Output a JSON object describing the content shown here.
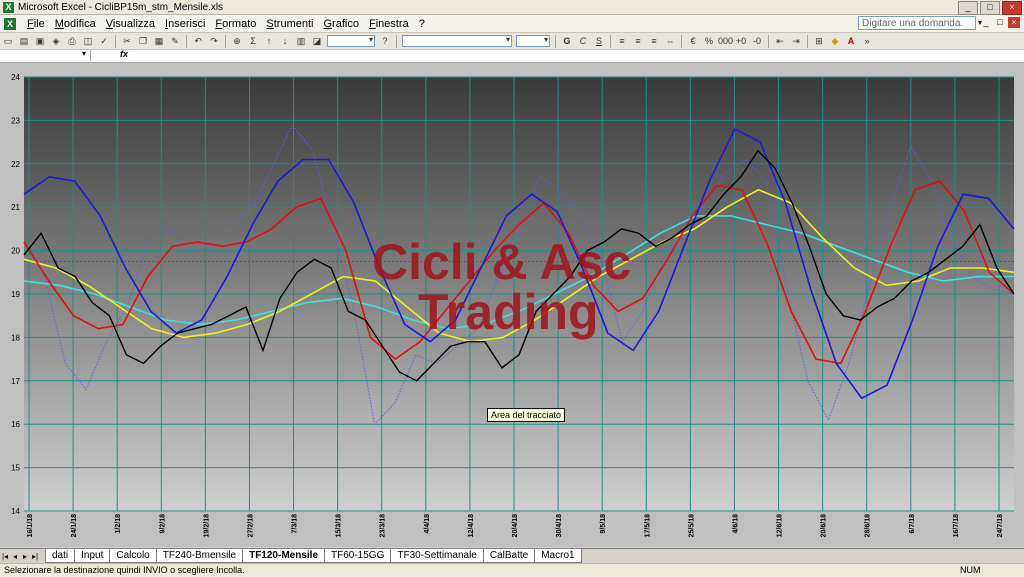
{
  "window": {
    "title": "Microsoft Excel - CicliBP15m_stm_Mensile.xls",
    "app_icon": "excel-icon",
    "buttons": [
      "_",
      "□",
      "×"
    ]
  },
  "menubar": {
    "items": [
      "File",
      "Modifica",
      "Visualizza",
      "Inserisci",
      "Formato",
      "Strumenti",
      "Grafico",
      "Finestra",
      "?"
    ],
    "ask_placeholder": "Digitare una domanda.",
    "doc_buttons": [
      "_",
      "□",
      "×"
    ]
  },
  "formulabar": {
    "fx": "fx"
  },
  "chart": {
    "watermark_line1": "Cicli & Asc",
    "watermark_line2": "Trading",
    "tooltip": "Area del tracciato",
    "colors": {
      "background_top": "#3a3a3a",
      "background_bottom": "#c8c8c8",
      "grid": "#1f8f86",
      "black_series": "#000000",
      "blue_series": "#1a1ad8",
      "red_series": "#e01010",
      "yellow_series": "#f0f020",
      "cyan_series": "#40e0e0",
      "dotted_series": "#6060e0",
      "reference_line": "#e02020"
    }
  },
  "chart_data": {
    "type": "line",
    "ylim": [
      14,
      24
    ],
    "yticks": [
      14,
      15,
      16,
      17,
      18,
      19,
      20,
      21,
      22,
      23,
      24
    ],
    "xticks": [
      "16/1/18",
      "24/1/18",
      "1/2/18",
      "9/2/18",
      "19/2/18",
      "27/2/18",
      "7/3/18",
      "15/3/18",
      "23/3/18",
      "4/4/18",
      "12/4/18",
      "20/4/18",
      "30/4/18",
      "9/5/18",
      "17/5/18",
      "25/5/18",
      "4/6/18",
      "12/6/18",
      "20/6/18",
      "28/6/18",
      "6/7/18",
      "16/7/18",
      "24/7/18"
    ],
    "reference_line": 19.75,
    "grid": true,
    "series": [
      {
        "color": "#000000",
        "style": "solid",
        "values": [
          19.9,
          20.4,
          19.6,
          19.4,
          18.8,
          18.5,
          17.6,
          17.4,
          17.8,
          18.1,
          18.2,
          18.3,
          18.5,
          18.7,
          17.7,
          18.9,
          19.5,
          19.8,
          19.6,
          18.6,
          18.4,
          17.8,
          17.2,
          17.0,
          17.4,
          17.8,
          17.9,
          17.9,
          17.3,
          17.6,
          18.6,
          19.0,
          19.4,
          20.0,
          20.2,
          20.5,
          20.4,
          20.1,
          20.3,
          20.6,
          20.8,
          21.3,
          21.7,
          22.3,
          21.9,
          21.1,
          20.1,
          19.0,
          18.5,
          18.4,
          18.7,
          18.9,
          19.3,
          19.5,
          19.8,
          20.1,
          20.6,
          19.6,
          19.0
        ]
      },
      {
        "color": "#1a1ad8",
        "style": "solid",
        "values": [
          21.3,
          21.7,
          21.6,
          20.8,
          19.6,
          18.6,
          18.1,
          18.4,
          19.4,
          20.6,
          21.6,
          22.1,
          22.1,
          21.1,
          19.6,
          18.3,
          17.9,
          18.4,
          19.6,
          20.8,
          21.3,
          20.9,
          19.6,
          18.1,
          17.7,
          18.6,
          20.1,
          21.6,
          22.8,
          22.5,
          21.1,
          19.1,
          17.4,
          16.6,
          16.9,
          18.4,
          20.1,
          21.3,
          21.2,
          20.5
        ]
      },
      {
        "color": "#e01010",
        "style": "solid",
        "values": [
          20.2,
          19.3,
          18.5,
          18.2,
          18.3,
          19.4,
          20.1,
          20.2,
          20.1,
          20.2,
          20.5,
          21.0,
          21.2,
          20.0,
          18.0,
          17.5,
          17.9,
          18.6,
          19.3,
          20.0,
          20.6,
          21.1,
          20.4,
          19.2,
          18.6,
          18.9,
          19.8,
          20.8,
          21.5,
          21.4,
          20.2,
          18.6,
          17.5,
          17.4,
          18.6,
          20.1,
          21.4,
          21.6,
          20.9,
          19.5,
          19.0
        ]
      },
      {
        "color": "#f0f020",
        "style": "solid",
        "values": [
          19.8,
          19.6,
          19.2,
          18.7,
          18.2,
          18.0,
          18.1,
          18.3,
          18.6,
          19.0,
          19.4,
          19.3,
          18.7,
          18.1,
          17.9,
          18.0,
          18.4,
          18.9,
          19.4,
          19.8,
          20.2,
          20.5,
          21.0,
          21.4,
          21.1,
          20.3,
          19.6,
          19.2,
          19.3,
          19.6,
          19.6,
          19.5
        ]
      },
      {
        "color": "#40e0e0",
        "style": "solid",
        "values": [
          19.3,
          19.2,
          19.0,
          18.7,
          18.4,
          18.3,
          18.4,
          18.6,
          18.8,
          18.9,
          18.7,
          18.4,
          18.2,
          18.3,
          18.6,
          19.0,
          19.4,
          19.9,
          20.4,
          20.8,
          20.8,
          20.6,
          20.4,
          20.1,
          19.8,
          19.5,
          19.3,
          19.4,
          19.4
        ]
      },
      {
        "color": "#6060e0",
        "style": "dotted",
        "values": [
          20.2,
          19.4,
          17.4,
          16.8,
          17.9,
          18.7,
          20.2,
          20.6,
          19.9,
          20.1,
          20.6,
          20.9,
          21.9,
          22.9,
          22.3,
          20.5,
          18.6,
          16.0,
          16.5,
          17.6,
          17.4,
          17.8,
          18.2,
          19.4,
          20.3,
          21.7,
          21.4,
          20.8,
          19.8,
          17.9,
          18.6,
          19.8,
          20.5,
          21.1,
          21.8,
          22.1,
          21.6,
          19.1,
          17.0,
          16.1,
          17.4,
          19.2,
          21.0,
          22.4,
          21.6,
          20.2,
          19.4,
          19.1,
          19.0
        ]
      }
    ]
  },
  "sheet_tabs": {
    "nav": [
      "|◂",
      "◂",
      "▸",
      "▸|"
    ],
    "tabs": [
      "dati",
      "Input",
      "Calcolo",
      "TF240-Bmensile",
      "TF120-Mensile",
      "TF60-15GG",
      "TF30-Settimanale",
      "CalBatte",
      "Macro1"
    ],
    "active": "TF120-Mensile"
  },
  "statusbar": {
    "message": "Selezionare la destinazione quindi INVIO o scegliere Incolla.",
    "num": "NUM"
  }
}
